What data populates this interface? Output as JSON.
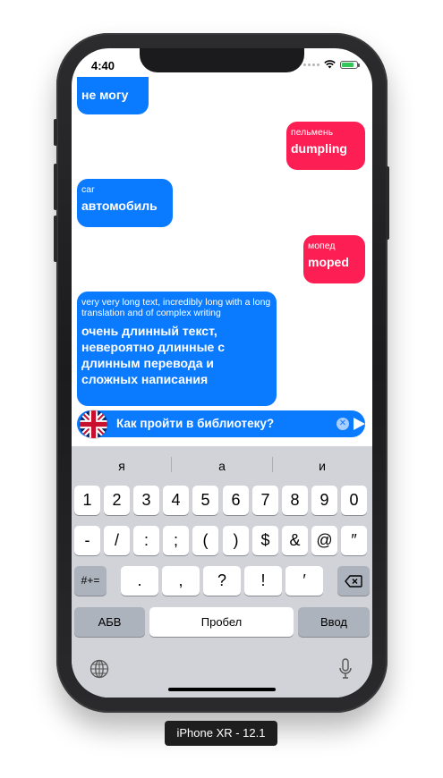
{
  "status": {
    "time": "4:40"
  },
  "chat": {
    "messages": [
      {
        "side": "left",
        "source": "",
        "target": "не могу"
      },
      {
        "side": "right",
        "source": "пельмень",
        "target": "dumpling"
      },
      {
        "side": "left",
        "source": "car",
        "target": "автомобиль"
      },
      {
        "side": "right",
        "source": "мопед",
        "target": "moped"
      },
      {
        "side": "left",
        "source": "very very long text, incredibly long with a long translation and of complex writing",
        "target": "очень длинный текст, невероятно длинные с длинным перевода и сложных написания"
      }
    ]
  },
  "input": {
    "value": "Как пройти в библиотеку?",
    "flag_icon": "uk-flag-icon"
  },
  "keyboard": {
    "suggestions": [
      "я",
      "а",
      "и"
    ],
    "row1": [
      "1",
      "2",
      "3",
      "4",
      "5",
      "6",
      "7",
      "8",
      "9",
      "0"
    ],
    "row2": [
      "-",
      "/",
      ":",
      ";",
      "(",
      ")",
      "$",
      "&",
      "@",
      "″"
    ],
    "row3_left": "#+=",
    "row3": [
      ".",
      ",",
      "?",
      "!",
      "′"
    ],
    "abc_label": "АБВ",
    "space_label": "Пробел",
    "return_label": "Ввод"
  },
  "device_label": "iPhone XR - 12.1",
  "colors": {
    "left_bubble": "#0a7aff",
    "right_bubble": "#fd1e53",
    "keyboard_bg": "#d1d3d9"
  }
}
